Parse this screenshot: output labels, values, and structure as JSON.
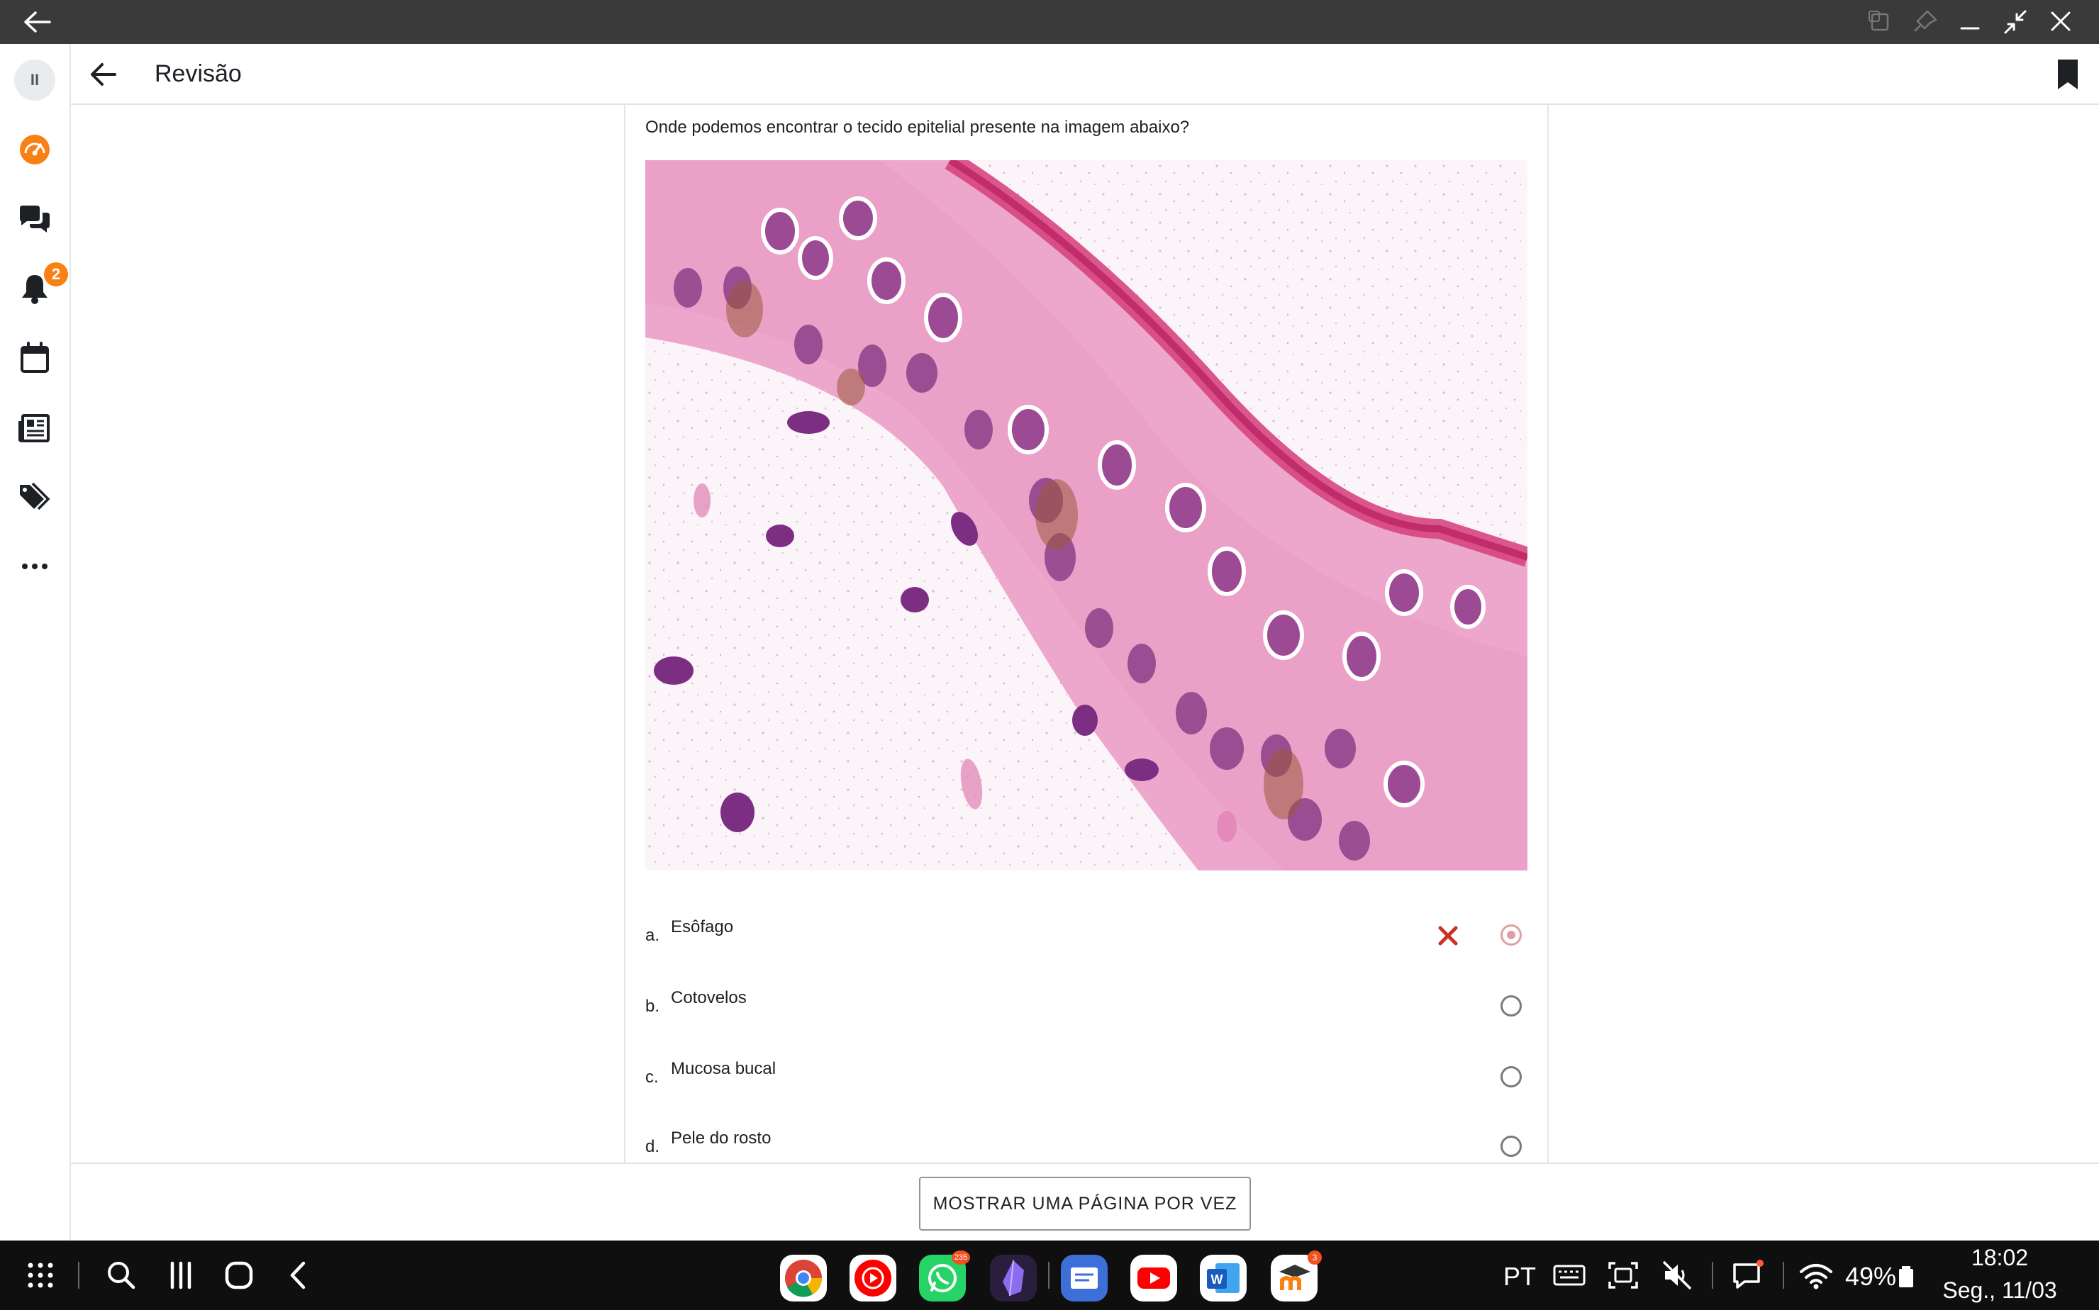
{
  "header": {
    "title": "Revisão"
  },
  "rail": {
    "pill_label": "II",
    "notification_count": "2",
    "items": [
      "dashboard-icon",
      "chat-icon",
      "bell-icon",
      "calendar-icon",
      "news-icon",
      "tags-icon",
      "more-icon"
    ]
  },
  "question": {
    "text": "Onde podemos encontrar o tecido epitelial presente na imagem abaixo?",
    "answers": [
      {
        "letter": "a.",
        "text": "Esôfago",
        "selected": true,
        "incorrect": true
      },
      {
        "letter": "b.",
        "text": "Cotovelos",
        "selected": false
      },
      {
        "letter": "c.",
        "text": "Mucosa bucal",
        "selected": false
      },
      {
        "letter": "d.",
        "text": "Pele do rosto",
        "selected": false
      }
    ]
  },
  "footer": {
    "button_label": "MOSTRAR UMA PÁGINA POR VEZ"
  },
  "taskbar": {
    "apps": [
      {
        "name": "chrome-icon"
      },
      {
        "name": "youtube-music-icon"
      },
      {
        "name": "whatsapp-icon",
        "badge": "235"
      },
      {
        "name": "obsidian-icon"
      },
      {
        "name": "notes-icon"
      },
      {
        "name": "youtube-icon"
      },
      {
        "name": "word-icon"
      },
      {
        "name": "moodle-icon",
        "badge": "3"
      }
    ],
    "language": "PT",
    "battery": "49%",
    "time": "18:02",
    "date": "Seg., 11/03"
  },
  "colors": {
    "accent": "#f98012",
    "wrong": "#ca3120",
    "system_bar": "#3a3a3a",
    "taskbar": "#0f0f0f"
  }
}
